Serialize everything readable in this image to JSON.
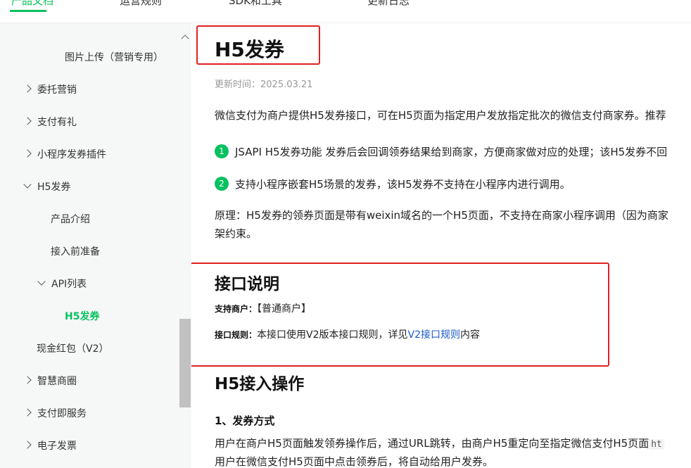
{
  "topnav": {
    "tabs": [
      "产品文档",
      "运营规则",
      "SDK和工具",
      "更新日志"
    ]
  },
  "sidebar": {
    "items": [
      {
        "label": "图片上传（营销专用）",
        "chevron": "none"
      },
      {
        "label": "委托营销",
        "chevron": "right"
      },
      {
        "label": "支付有礼",
        "chevron": "right"
      },
      {
        "label": "小程序发券插件",
        "chevron": "right"
      },
      {
        "label": "H5发券",
        "chevron": "down"
      },
      {
        "label": "产品介绍",
        "chevron": "none"
      },
      {
        "label": "接入前准备",
        "chevron": "none"
      },
      {
        "label": "API列表",
        "chevron": "down"
      },
      {
        "label": "H5发券",
        "chevron": "none",
        "active": true
      },
      {
        "label": "现金红包（V2）",
        "chevron": "none"
      },
      {
        "label": "智慧商圈",
        "chevron": "right"
      },
      {
        "label": "支付即服务",
        "chevron": "right"
      },
      {
        "label": "电子发票",
        "chevron": "right"
      }
    ]
  },
  "main": {
    "title": "H5发券",
    "updated": "更新时间：2025.03.21",
    "intro": "微信支付为商户提供H5发券接口，可在H5页面为指定用户发放指定批次的微信支付商家券。推荐",
    "points": [
      {
        "num": "1",
        "text": "JSAPI H5发券功能 发券后会回调领券结果给到商家，方便商家做对应的处理；该H5发券不回"
      },
      {
        "num": "2",
        "text": "支持小程序嵌套H5场景的发券，该H5发券不支持在小程序内进行调用。"
      }
    ],
    "principle_line1": "原理：H5发券的领券页面是带有weixin域名的一个H5页面，不支持在商家小程序调用（因为商家",
    "principle_line2": "架约束。",
    "api_section": {
      "title": "接口说明",
      "merchant_label": "支持商户：",
      "merchant_value": "【普通商户】",
      "rule_label": "接口规则：",
      "rule_text_before": "本接口使用V2版本接口规则，详见",
      "rule_link": "V2接口规则",
      "rule_text_after": "内容"
    },
    "h5_section": {
      "title": "H5接入操作",
      "subtitle": "1、发券方式",
      "line1": "用户在商户H5页面触发领券操作后，通过URL跳转，由商户H5重定向至指定微信支付H5页面",
      "line1_code": "ht",
      "line2": "用户在微信支付H5页面中点击领券后，将自动给用户发券。"
    }
  },
  "colors": {
    "accent": "#07c160",
    "highlight_box": "#e02020",
    "link": "#1a58c9"
  }
}
